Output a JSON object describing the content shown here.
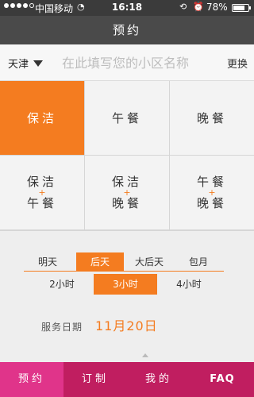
{
  "status_bar": {
    "carrier": "中国移动",
    "wifi_icon": "wifi-icon",
    "time": "16:18",
    "battery_percent": "78%",
    "battery_level": 0.78,
    "signal_bars": 4
  },
  "nav": {
    "title": "预约"
  },
  "search": {
    "city": "天津",
    "placeholder": "在此填写您的小区名称",
    "switch_label": "更换"
  },
  "services": [
    {
      "label": "保洁",
      "active": true
    },
    {
      "label": "午餐",
      "active": false
    },
    {
      "label": "晚餐",
      "active": false
    },
    {
      "top": "保洁",
      "plus": "+",
      "bottom": "午餐"
    },
    {
      "top": "保洁",
      "plus": "+",
      "bottom": "晚餐"
    },
    {
      "top": "午餐",
      "plus": "+",
      "bottom": "晚餐"
    }
  ],
  "day_options": [
    "明天",
    "后天",
    "大后天",
    "包月"
  ],
  "day_selected": "后天",
  "duration_options": [
    "2小时",
    "3小时",
    "4小时"
  ],
  "duration_selected": "3小时",
  "service_date": {
    "label": "服务日期",
    "value": "11月20日"
  },
  "tabbar": {
    "items": [
      "预约",
      "订制",
      "我的",
      "FAQ"
    ],
    "active": "预约"
  },
  "colors": {
    "accent": "#f47c20",
    "tabbar": "#c01e60",
    "tabbar_active": "#e0348a",
    "nav": "#4a4a4a"
  }
}
